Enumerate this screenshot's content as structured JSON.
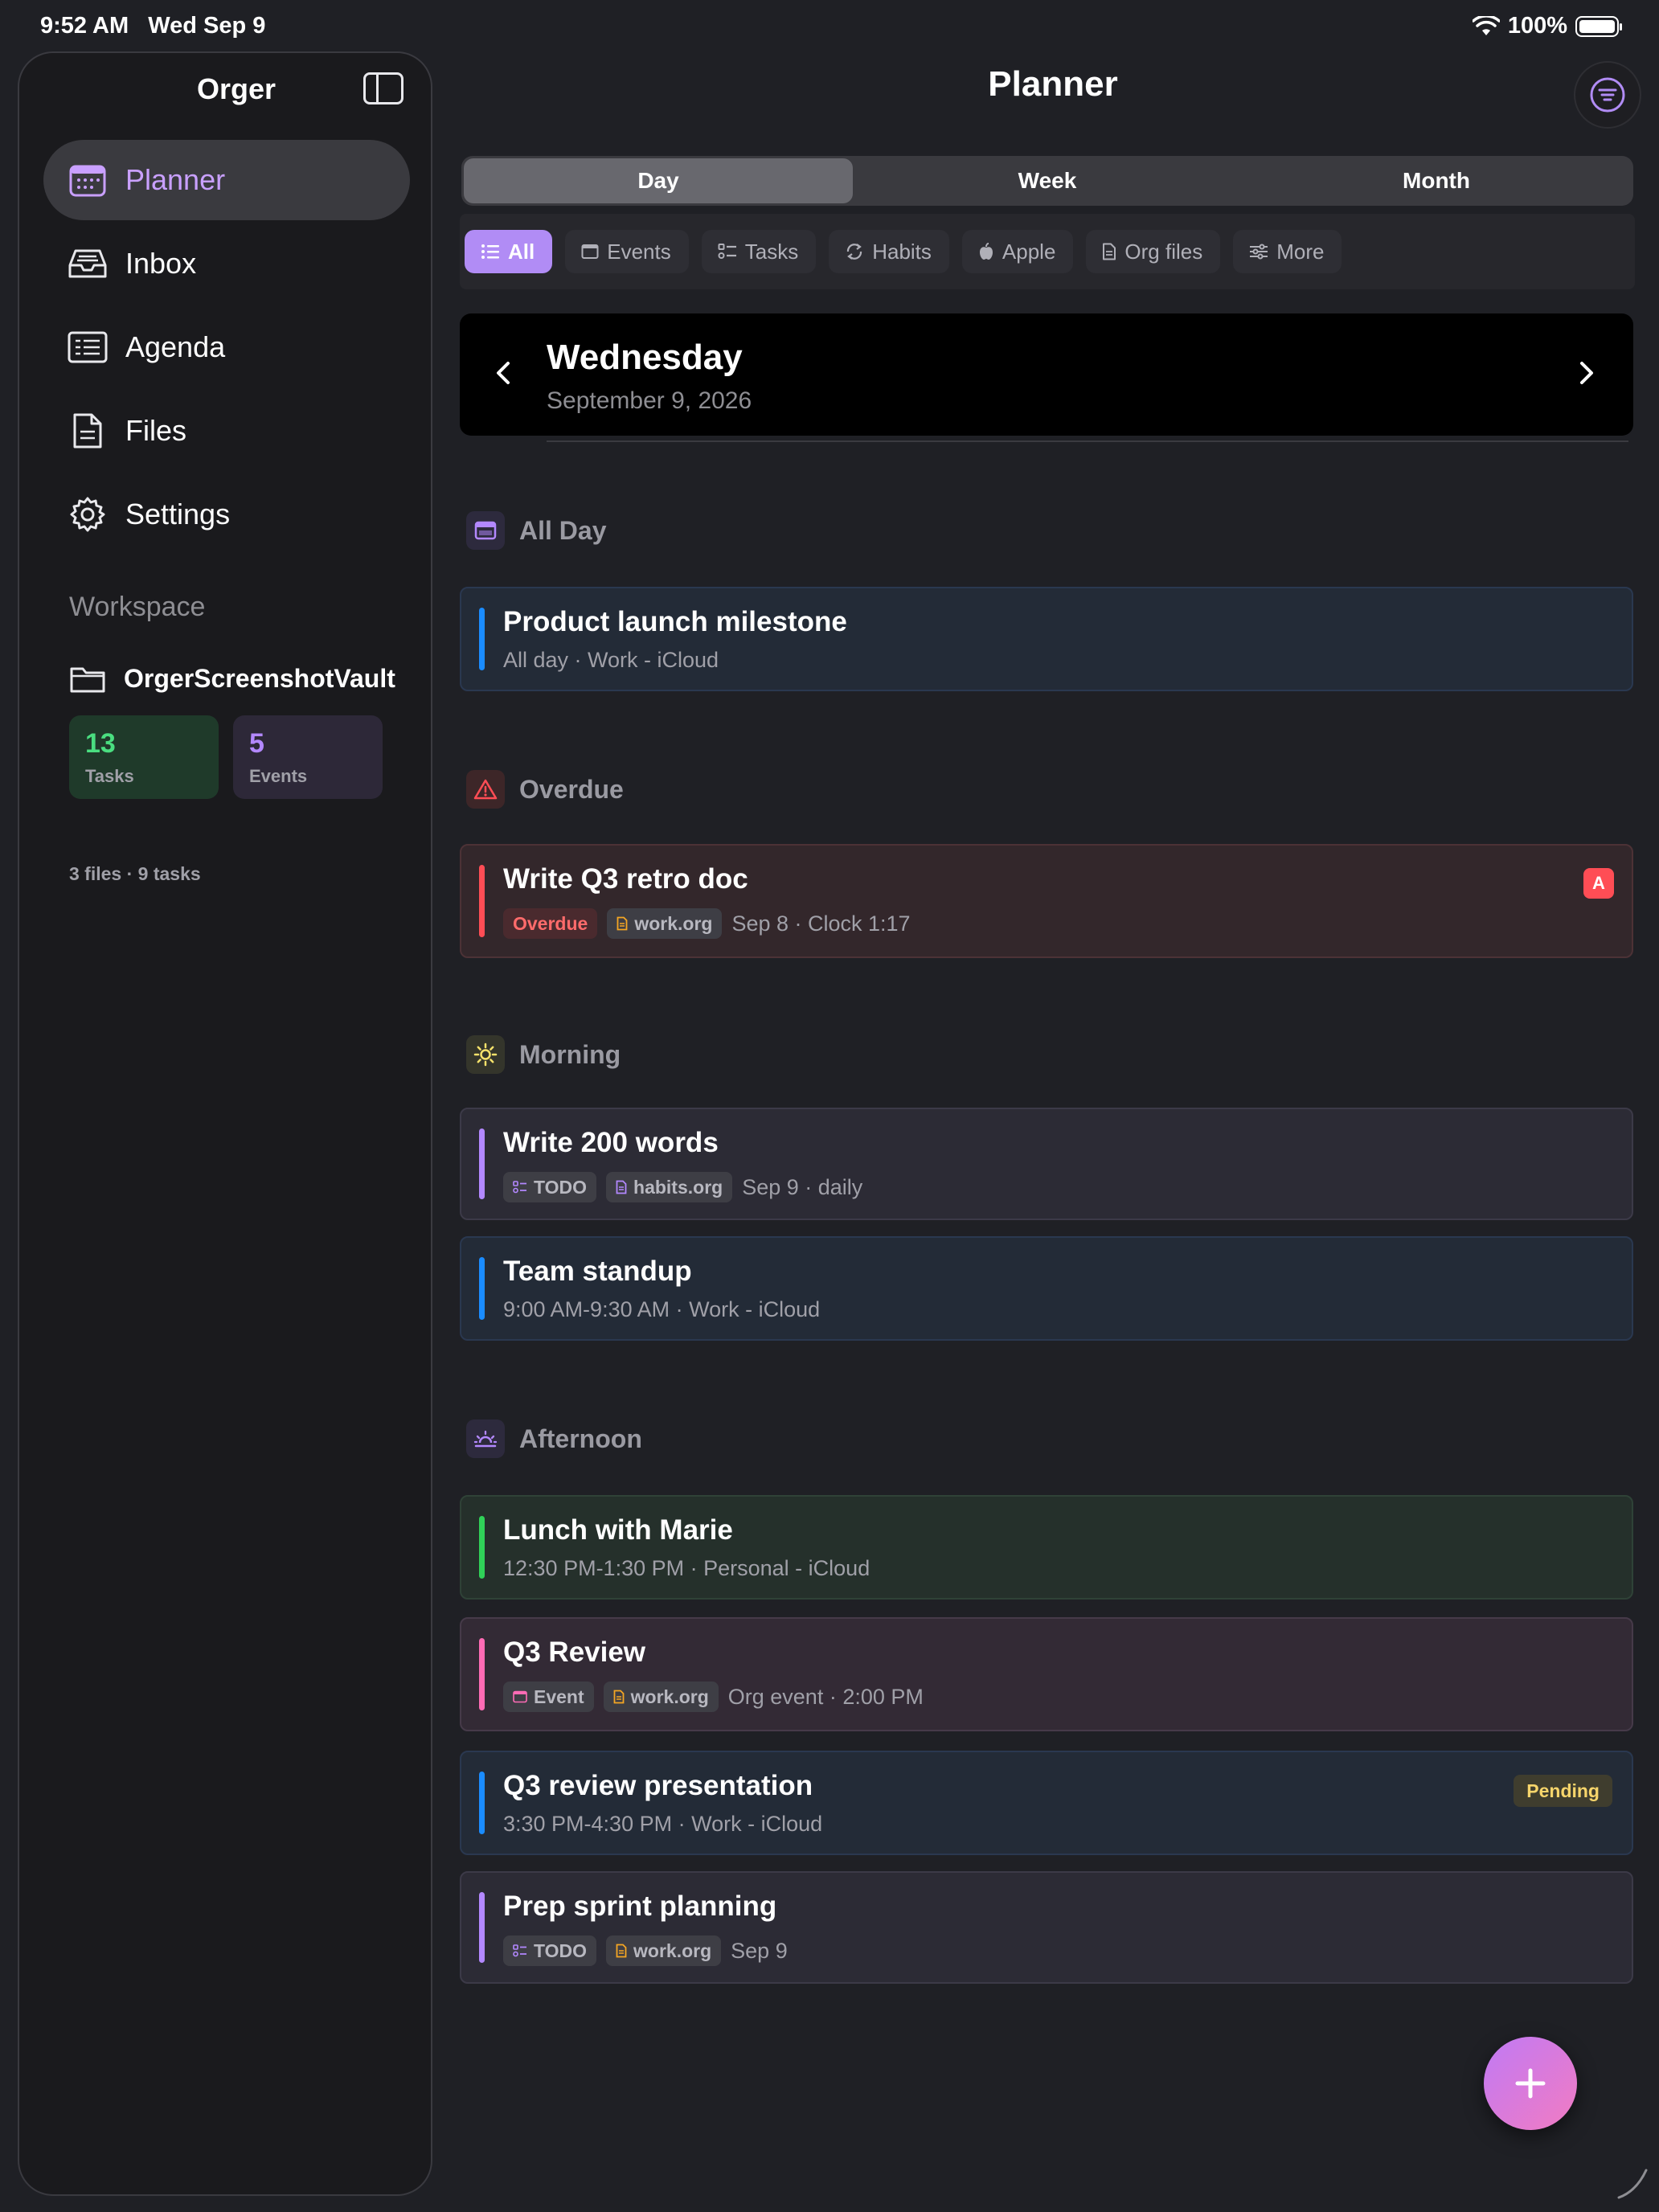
{
  "status_bar": {
    "time": "9:52 AM",
    "date": "Wed Sep 9",
    "battery": "100%"
  },
  "sidebar": {
    "title": "Orger",
    "items": [
      {
        "label": "Planner",
        "icon": "calendar-icon",
        "active": true
      },
      {
        "label": "Inbox",
        "icon": "inbox-icon",
        "active": false
      },
      {
        "label": "Agenda",
        "icon": "agenda-icon",
        "active": false
      },
      {
        "label": "Files",
        "icon": "file-icon",
        "active": false
      },
      {
        "label": "Settings",
        "icon": "gear-icon",
        "active": false
      }
    ],
    "workspace_title": "Workspace",
    "vault_name": "OrgerScreenshotVault",
    "stats": {
      "tasks_count": "13",
      "tasks_label": "Tasks",
      "events_count": "5",
      "events_label": "Events"
    },
    "summary": "3 files · 9 tasks"
  },
  "main": {
    "title": "Planner",
    "segments": [
      {
        "label": "Day",
        "active": true
      },
      {
        "label": "Week",
        "active": false
      },
      {
        "label": "Month",
        "active": false
      }
    ],
    "filters": [
      {
        "label": "All",
        "active": true
      },
      {
        "label": "Events",
        "active": false
      },
      {
        "label": "Tasks",
        "active": false
      },
      {
        "label": "Habits",
        "active": false
      },
      {
        "label": "Apple",
        "active": false
      },
      {
        "label": "Org files",
        "active": false
      },
      {
        "label": "More",
        "active": false
      }
    ],
    "date": {
      "weekday": "Wednesday",
      "full": "September 9, 2026"
    },
    "sections": {
      "all_day": "All Day",
      "overdue": "Overdue",
      "morning": "Morning",
      "afternoon": "Afternoon"
    },
    "items": {
      "product_launch": {
        "title": "Product launch milestone",
        "sub": "All day · Work - iCloud"
      },
      "q3_retro": {
        "title": "Write Q3 retro doc",
        "status": "Overdue",
        "file": "work.org",
        "detail": "Sep 8 · Clock 1:17",
        "priority": "A"
      },
      "write_words": {
        "title": "Write 200 words",
        "state": "TODO",
        "file": "habits.org",
        "detail": "Sep 9 · daily"
      },
      "standup": {
        "title": "Team standup",
        "sub": "9:00 AM-9:30 AM · Work - iCloud"
      },
      "lunch": {
        "title": "Lunch with Marie",
        "sub": "12:30 PM-1:30 PM · Personal - iCloud"
      },
      "q3_review": {
        "title": "Q3 Review",
        "type": "Event",
        "file": "work.org",
        "detail": "Org event · 2:00 PM"
      },
      "q3_presentation": {
        "title": "Q3 review presentation",
        "sub": "3:30 PM-4:30 PM · Work - iCloud",
        "badge": "Pending"
      },
      "sprint": {
        "title": "Prep sprint planning",
        "state": "TODO",
        "file": "work.org",
        "detail": "Sep 9"
      }
    }
  },
  "colors": {
    "accent": "#b18cf5",
    "blue_bar": "#1a8cff",
    "red_bar": "#ff4d55",
    "purple_bar": "#b388ff",
    "green_bar": "#30d158",
    "pink_bar": "#ff6bb5"
  }
}
